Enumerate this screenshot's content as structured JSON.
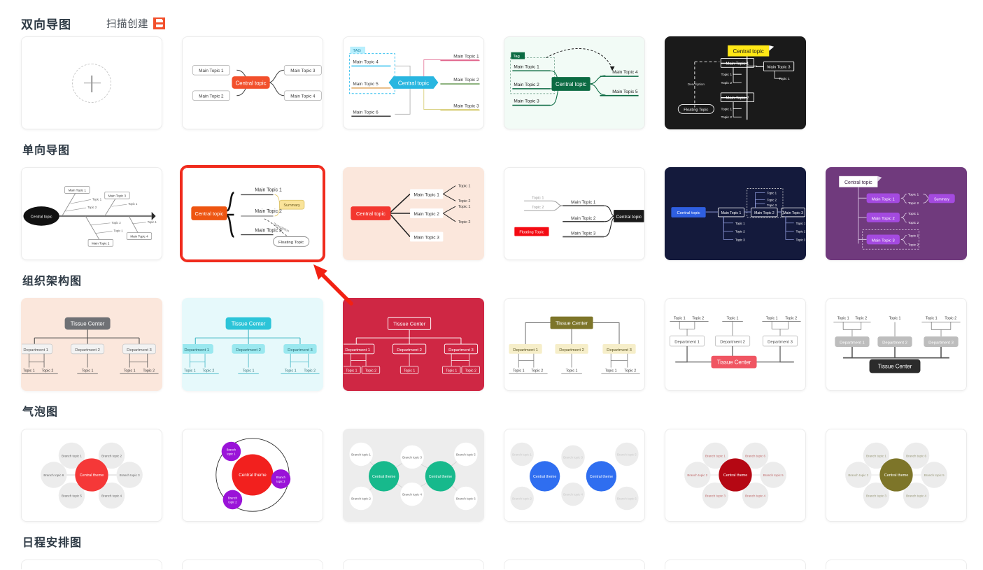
{
  "header": {
    "title": "双向导图",
    "scan_create_label": "扫描创建",
    "scan_icon": "scan-qr-icon"
  },
  "sections": [
    {
      "id": "bidirectional",
      "title": "双向导图"
    },
    {
      "id": "unidirectional",
      "title": "单向导图"
    },
    {
      "id": "org_chart",
      "title": "组织架构图"
    },
    {
      "id": "bubble_chart",
      "title": "气泡图"
    },
    {
      "id": "schedule",
      "title": "日程安排图"
    }
  ],
  "new_map": {
    "label": "",
    "icon": "plus-icon"
  },
  "labels": {
    "central_topic": "Central topic",
    "central_theme": "Central theme",
    "tissue_center": "Tissue Center",
    "floating_topic": "Floating Topic",
    "summary": "Summary",
    "description": "Description",
    "tag_upper": "TAG",
    "tag_lower": "Tag",
    "main_topic_1": "Main Topic 1",
    "main_topic_2": "Main Topic 2",
    "main_topic_3": "Main Topic 3",
    "main_topic_4": "Main Topic 4",
    "main_topic_5": "Main Topic 5",
    "main_topic_6": "Main Topic 6",
    "topic_1": "Topic 1",
    "topic_2": "Topic 2",
    "topic_3": "Topic 3",
    "department_1": "Department 1",
    "department_2": "Department 2",
    "department_3": "Department 3",
    "branch_topic_1": "Branch topic 1",
    "branch_topic_2": "Branch topic 2",
    "branch_topic_3": "Branch topic 3",
    "branch_topic_4": "Branch topic 4",
    "branch_topic_5": "Branch topic 5",
    "branch_topic_6": "Branch topic 6"
  },
  "colors": {
    "accent_orange": "#f2502c",
    "selected_border": "#f02b1d",
    "arrow_red": "#f22112",
    "cyan": "#29b6e0",
    "dark_green": "#0c6b43",
    "dark_bg": "#1a1a1a",
    "yellow": "#ffe816",
    "peach_bg": "#fbe7dc",
    "red": "#f3372f",
    "navy_bg": "#141a3c",
    "blue": "#2f5fe0",
    "purple_bg": "#703a7d",
    "purple": "#a44ae0",
    "gray": "#6f7175",
    "teal": "#17b98c",
    "crimson_bg": "#cf2744",
    "olive": "#7d7529",
    "cream": "#f6eec9",
    "dark_red": "#b50713",
    "bright_blue": "#2f6ef0",
    "bubble_gray": "#ececec",
    "card_border": "#ececec",
    "text_dark": "#2e3a45"
  },
  "cards": {
    "bidirectional": [
      {
        "name": "new-map-tile",
        "kind": "new"
      },
      {
        "name": "bidirectional-classic",
        "kind": "map"
      },
      {
        "name": "bidirectional-cyan-tag",
        "kind": "map"
      },
      {
        "name": "bidirectional-green-tag",
        "kind": "map"
      },
      {
        "name": "bidirectional-dark-yellow",
        "kind": "map"
      }
    ],
    "unidirectional": [
      {
        "name": "fishbone-gray",
        "kind": "map"
      },
      {
        "name": "unidirectional-orange-selected",
        "kind": "map",
        "selected": true
      },
      {
        "name": "unidirectional-peach-red",
        "kind": "map"
      },
      {
        "name": "unidirectional-rtl-black",
        "kind": "map"
      },
      {
        "name": "unidirectional-navy-blue",
        "kind": "map"
      },
      {
        "name": "unidirectional-purple",
        "kind": "map"
      }
    ],
    "org_chart": [
      {
        "name": "org-peach-gray",
        "kind": "map"
      },
      {
        "name": "org-cyan",
        "kind": "map"
      },
      {
        "name": "org-crimson",
        "kind": "map"
      },
      {
        "name": "org-olive-cream",
        "kind": "map"
      },
      {
        "name": "org-bottom-red",
        "kind": "map"
      },
      {
        "name": "org-bottom-black",
        "kind": "map"
      }
    ],
    "bubble_chart": [
      {
        "name": "bubble-red-six",
        "kind": "map"
      },
      {
        "name": "bubble-purple-circle",
        "kind": "map"
      },
      {
        "name": "bubble-teal-dual",
        "kind": "map"
      },
      {
        "name": "bubble-blue-dual",
        "kind": "map"
      },
      {
        "name": "bubble-darkred-six",
        "kind": "map"
      },
      {
        "name": "bubble-olive-six",
        "kind": "map"
      }
    ]
  }
}
